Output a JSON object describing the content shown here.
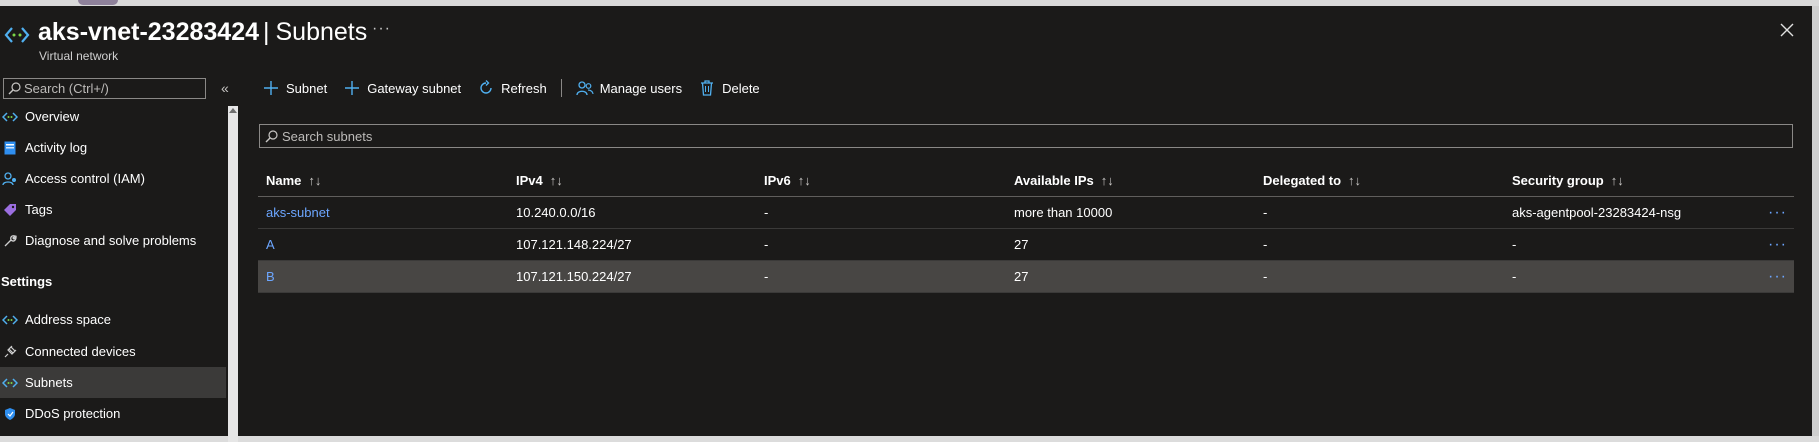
{
  "header": {
    "resource_name": "aks-vnet-23283424",
    "separator": "|",
    "page_title": "Subnets",
    "subtitle": "Virtual network",
    "more_label": "···",
    "close_label": "close"
  },
  "sidebar": {
    "search_placeholder": "Search (Ctrl+/)",
    "collapse_label": "«",
    "items": [
      {
        "label": "Overview",
        "icon": "vnet-icon"
      },
      {
        "label": "Activity log",
        "icon": "activity-log-icon"
      },
      {
        "label": "Access control (IAM)",
        "icon": "iam-icon"
      },
      {
        "label": "Tags",
        "icon": "tag-icon"
      },
      {
        "label": "Diagnose and solve problems",
        "icon": "wrench-icon"
      }
    ],
    "section_settings": "Settings",
    "settings_items": [
      {
        "label": "Address space",
        "icon": "vnet-icon"
      },
      {
        "label": "Connected devices",
        "icon": "plug-icon"
      },
      {
        "label": "Subnets",
        "icon": "vnet-icon",
        "selected": true
      },
      {
        "label": "DDoS protection",
        "icon": "shield-icon"
      }
    ]
  },
  "toolbar": {
    "subnet": "Subnet",
    "gateway_subnet": "Gateway subnet",
    "refresh": "Refresh",
    "manage_users": "Manage users",
    "delete": "Delete"
  },
  "search": {
    "placeholder": "Search subnets"
  },
  "table": {
    "sort_glyph": "↑↓",
    "columns": [
      "Name",
      "IPv4",
      "IPv6",
      "Available IPs",
      "Delegated to",
      "Security group"
    ],
    "rows": [
      {
        "name": "aks-subnet",
        "ipv4": "10.240.0.0/16",
        "ipv6": "-",
        "available": "more than 10000",
        "delegated": "-",
        "nsg": "aks-agentpool-23283424-nsg",
        "more": "···"
      },
      {
        "name": "A",
        "ipv4": "107.121.148.224/27",
        "ipv6": "-",
        "available": "27",
        "delegated": "-",
        "nsg": "-",
        "more": "···"
      },
      {
        "name": "B",
        "ipv4": "107.121.150.224/27",
        "ipv6": "-",
        "available": "27",
        "delegated": "-",
        "nsg": "-",
        "more": "···",
        "highlighted": true
      }
    ]
  },
  "colors": {
    "background": "#1b1a19",
    "link": "#6ca6ff",
    "selected_nav": "#3b3a39",
    "highlight_row": "#484644",
    "icon_blue": "#50b0f0"
  }
}
